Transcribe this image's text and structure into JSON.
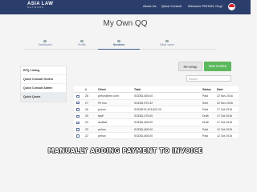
{
  "header": {
    "logo_name": "ASIA LAW",
    "logo_sub": "NETWORK",
    "nav": [
      "About Us",
      "Quick Consult",
      "Welcome PEHON, Ong!"
    ],
    "flag_colors": [
      "#d8232a",
      "#ffffff"
    ]
  },
  "page_title": "My Own QQ",
  "tabs": [
    {
      "label": "Dashboard",
      "active": false
    },
    {
      "label": "Profile",
      "active": false
    },
    {
      "label": "Services",
      "active": true
    },
    {
      "label": "Other users",
      "active": false
    }
  ],
  "sidebar": {
    "items": [
      {
        "label": "RFQ Listing",
        "active": false
      },
      {
        "label": "Quick Consult Orders",
        "active": false
      },
      {
        "label": "Quick Consult Admin",
        "active": false
      },
      {
        "label": "Quick Quote",
        "active": true
      }
    ]
  },
  "actions": {
    "resetup_label": "Re-setup",
    "new_invoice_label": "New Invoice",
    "new_invoice_color": "#5cb85c"
  },
  "search": {
    "placeholder": "Search"
  },
  "table": {
    "headers": [
      "#",
      "Client",
      "Total",
      "Status",
      "Date"
    ],
    "rows": [
      {
        "id": "28",
        "client": "pehon@me.com",
        "total": "SGD$1,605.00",
        "status": "Paid",
        "date": "22 Nov 2016"
      },
      {
        "id": "27",
        "client": "Pe hon",
        "total": "SGD$1,579.32",
        "status": "Sent",
        "date": "22 Nov 2016"
      },
      {
        "id": "26",
        "client": "pehon",
        "total": "SGD$279,423,823.20",
        "status": "Paid",
        "date": "17 Oct 2016"
      },
      {
        "id": "25",
        "client": "fpalf",
        "total": "SGD$1,476.00",
        "status": "Draft",
        "date": "17 Oct 2016"
      },
      {
        "id": "24",
        "client": "asdfsdf",
        "total": "SGD$1,605.00",
        "status": "Draft",
        "date": "17 Oct 2016"
      },
      {
        "id": "23",
        "client": "pehon",
        "total": "SGD$1,605.00",
        "status": "Paid",
        "date": "12 Oct 2016"
      },
      {
        "id": "22",
        "client": "pehon",
        "total": "SGD$1,605.00",
        "status": "Paid",
        "date": "12 Oct 2016"
      }
    ]
  },
  "caption": "MANUALLY ADDING PAYMENT TO INVOICE"
}
